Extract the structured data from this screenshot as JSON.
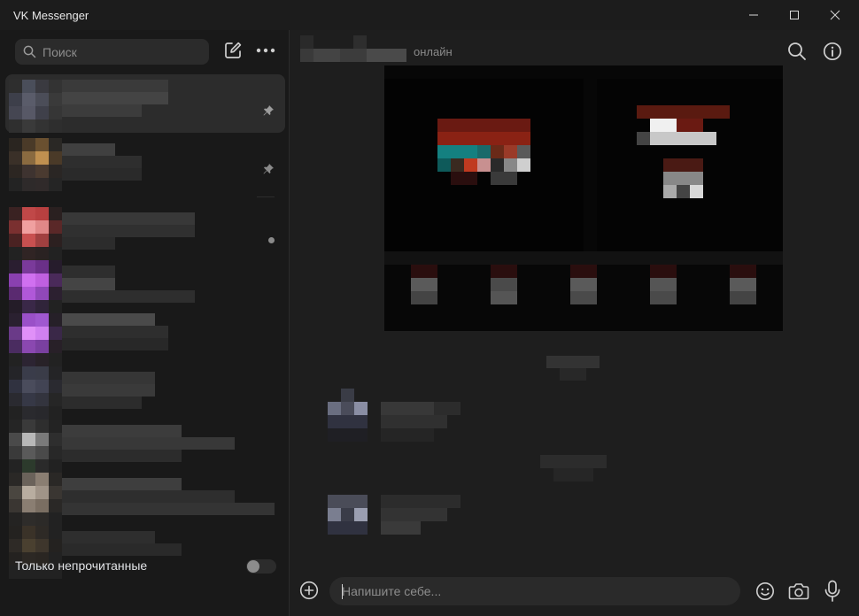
{
  "window": {
    "title": "VK Messenger",
    "controls": {
      "minimize_icon": "minimize-icon",
      "maximize_icon": "maximize-icon",
      "close_icon": "close-icon"
    }
  },
  "sidebar": {
    "search": {
      "placeholder": "Поиск",
      "icon": "search-icon"
    },
    "compose_icon": "compose-icon",
    "more_icon": "more-dots-icon",
    "filter": {
      "label": "Только непрочитанные",
      "toggle_on": false
    }
  },
  "chat": {
    "header": {
      "status": "онлайн"
    },
    "composer": {
      "placeholder": "Напишите себе...",
      "attach_icon": "add-icon",
      "emoji_icon": "emoji-icon",
      "camera_icon": "camera-icon",
      "mic_icon": "microphone-icon"
    }
  },
  "colors": {
    "background": "#1e1e1e",
    "sidebar": "#191919",
    "active_row": "#2c2c2c",
    "input": "#2a2a2a",
    "muted_text": "#8a8a8a"
  }
}
